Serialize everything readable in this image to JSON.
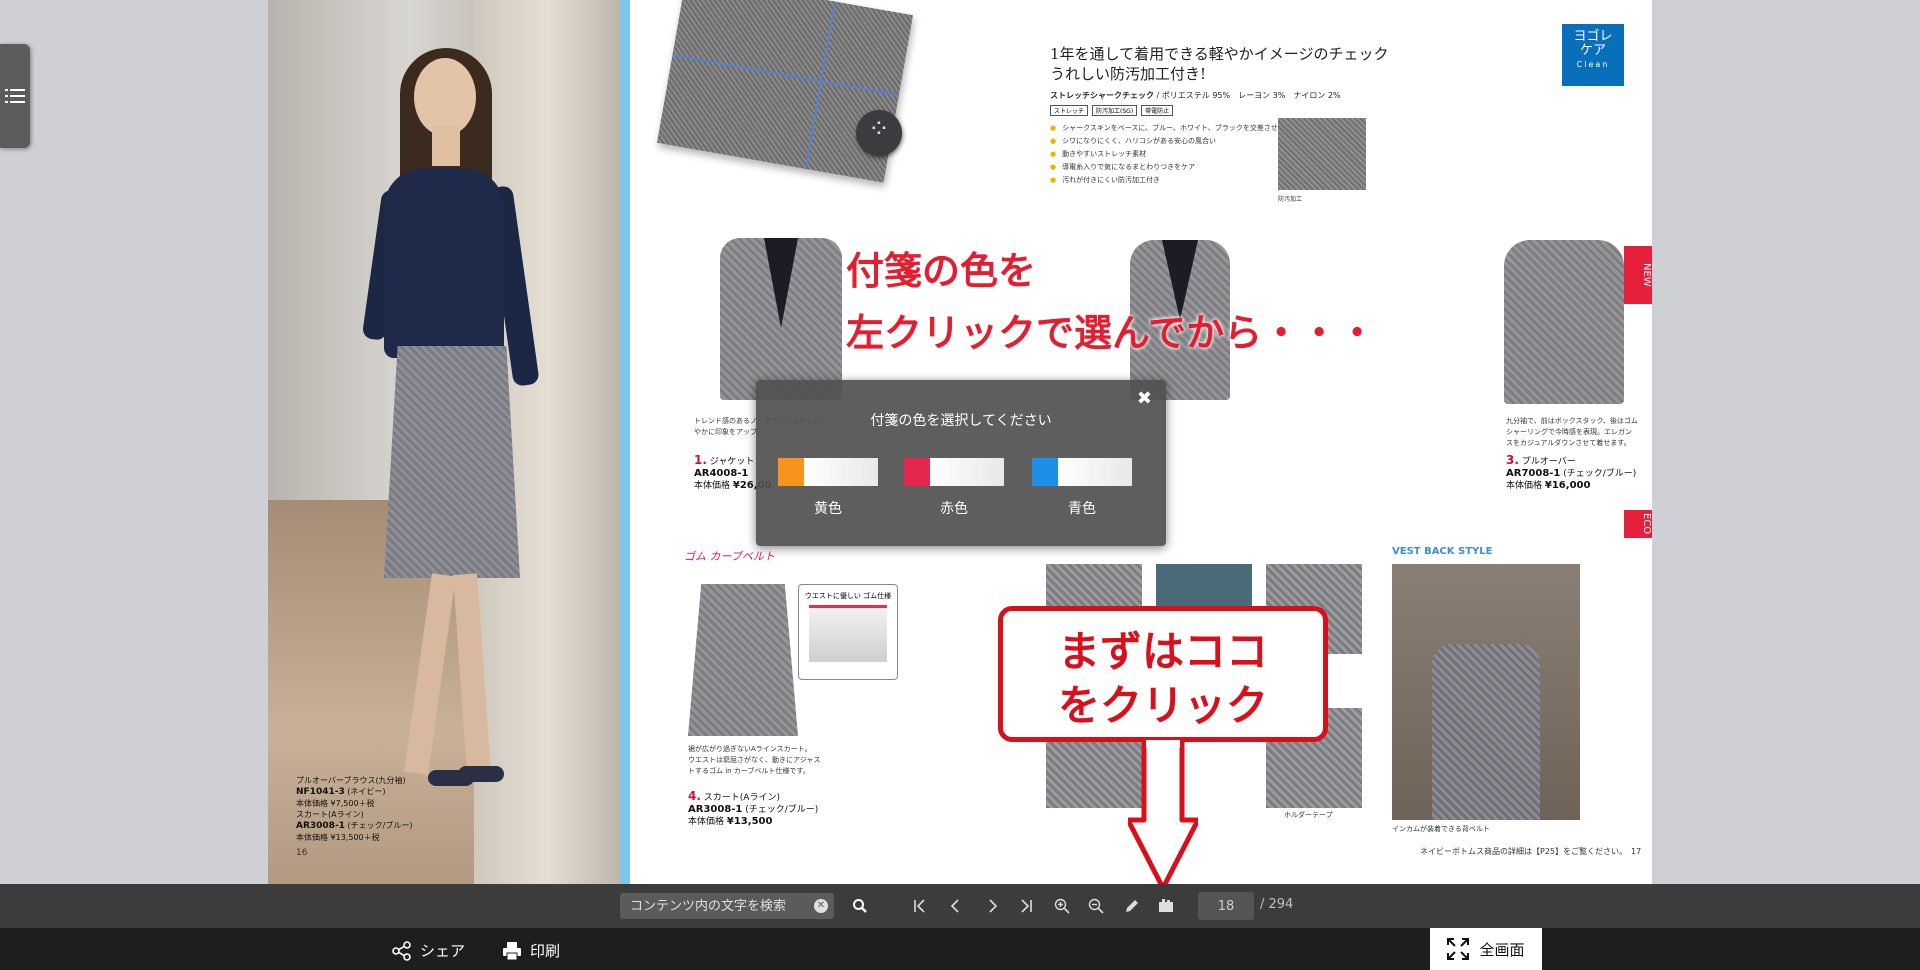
{
  "catalog": {
    "left": {
      "caption_l1": "プルオーバーブラウス(九分袖)",
      "caption_l2": "NF1041-3",
      "caption_l2b": "(ネイビー)",
      "caption_l3": "本体価格 ¥7,500＋税",
      "caption_l4": "スカート(Aライン)",
      "caption_l5": "AR3008-1",
      "caption_l5b": "(チェック/ブルー)",
      "caption_l6": "本体価格 ¥13,500＋税",
      "page_number": "16"
    },
    "right": {
      "headline_1": "1年を通して着用できる軽やかイメージのチェック",
      "headline_2": "うれしい防汚加工付き!",
      "material_name": "ストレッチシャークチェック",
      "material_comp": "/ ポリエステル 95%　レーヨン 3%　ナイロン 2%",
      "tags": [
        "ストレッチ",
        "防汚加工(SG)",
        "帯電防止"
      ],
      "features": [
        "シャークスキンをベースに、ブルー、ホワイト、ブラックを交差させた清楚チェック",
        "シワになりにくく、ハリコシがある安心の風合い",
        "動きやすいストレッチ素材",
        "導電糸入りで気になるまとわりつきをケア",
        "汚れが付きにくい防汚加工付き"
      ],
      "swatch_caption": "防汚加工",
      "badge_line1": "ヨゴレ",
      "badge_line2": "ケア",
      "badge_sub": "Clean",
      "new_tab": "NEW",
      "eco_tab": "ECO",
      "item1_desc_1": "トレンド感のあるノーカラージャケット。",
      "item1_desc_2": "やかに印象をアップ。",
      "item1_number": "1.",
      "item1_name": "ジャケット",
      "item1_code": "AR4008-1",
      "item1_price_label": "本体価格",
      "item1_price": "¥26,00",
      "item3_number": "3.",
      "item3_name": "プルオーバー",
      "item3_code": "AR7008-1",
      "item3_sub": "(チェック/ブルー)",
      "item3_price_label": "本体価格",
      "item3_price": "¥16,000",
      "item3_desc_1": "九分袖で、前はボックスタック、後はゴム",
      "item3_desc_2": "シャーリングで今時感を表現。エレガン",
      "item3_desc_3": "スをカジュアルダウンさせて着せます。",
      "gomu_label": "ゴム カーブベルト",
      "waist_title": "ウエストに優しい ゴム仕様",
      "item4_desc_1": "裾が広がり過ぎないAラインスカート。",
      "item4_desc_2": "ウエストは窮屈さがなく、動きにアジャス",
      "item4_desc_3": "トするゴム in カーブベルト仕様です。",
      "item4_number": "4.",
      "item4_name": "スカート(Aライン)",
      "item4_code": "AR3008-1",
      "item4_sub": "(チェック/ブルー)",
      "item4_price_label": "本体価格",
      "item4_price": "¥13,500",
      "vest_back_title": "VEST BACK STYLE",
      "vest_back_caption": "インカムが装着できる背ベルト",
      "holder_caption": "ホルダーテープ",
      "footer_note": "ネイビーボトムス商品の詳細は【P25】をご覧ください。",
      "page_number": "17"
    }
  },
  "annotations": {
    "instruction_line1": "付箋の色を",
    "instruction_line2": "左クリックで選んでから・・・",
    "callout_line1": "まずはココ",
    "callout_line2": "をクリック",
    "accent_color": "#d8101c"
  },
  "dialog": {
    "title": "付箋の色を選択してください",
    "close_icon": "close-icon",
    "options": [
      {
        "label": "黄色",
        "color": "#f7941d"
      },
      {
        "label": "赤色",
        "color": "#e5264f"
      },
      {
        "label": "青色",
        "color": "#1e8fe6"
      }
    ]
  },
  "toolbar": {
    "search_placeholder": "コンテンツ内の文字を検索",
    "current_page": "18",
    "total_pages": "/ 294",
    "icons": [
      "first-page-icon",
      "prev-page-icon",
      "next-page-icon",
      "last-page-icon",
      "zoom-in-icon",
      "zoom-out-icon",
      "pen-icon",
      "sticky-note-icon"
    ]
  },
  "bottombar": {
    "share_label": "シェア",
    "print_label": "印刷",
    "fullscreen_label": "全画面"
  }
}
